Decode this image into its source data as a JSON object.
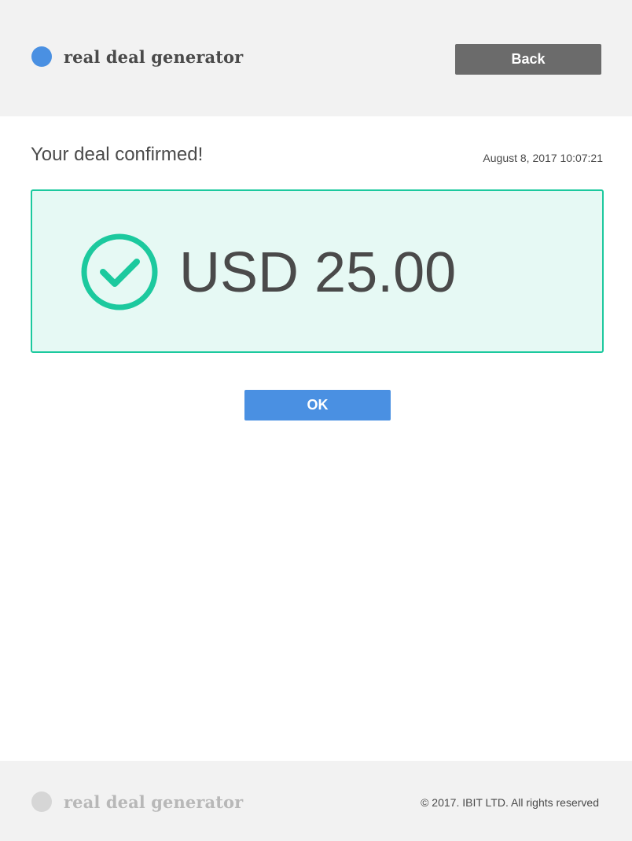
{
  "brand": {
    "name": "real deal generator",
    "accent_color": "#4a90e2",
    "footer_dot_color": "#d6d6d6"
  },
  "header": {
    "back_label": "Back"
  },
  "confirmation": {
    "title": "Your deal confirmed!",
    "timestamp": "August 8, 2017 10:07:21",
    "status_icon": "check-circle-icon",
    "status_color": "#1cc99e",
    "amount": "USD 25.00"
  },
  "actions": {
    "ok_label": "OK"
  },
  "footer": {
    "brand_name": "real deal generator",
    "copyright": "© 2017. IBIT LTD. All rights reserved"
  }
}
